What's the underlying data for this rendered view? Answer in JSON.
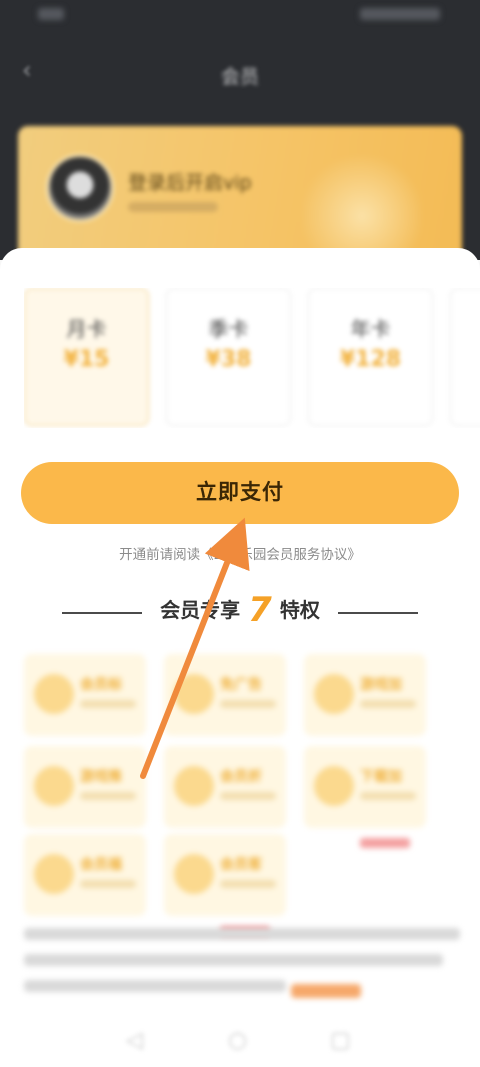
{
  "header": {
    "title": "会员",
    "back_glyph": "‹"
  },
  "vip_card": {
    "username": "登录后开启vip"
  },
  "plans": [
    {
      "name": "月卡",
      "price": "¥15"
    },
    {
      "name": "季卡",
      "price": "¥38"
    },
    {
      "name": "年卡",
      "price": "¥128"
    },
    {
      "name": "",
      "price": "¥"
    }
  ],
  "pay_button": {
    "label": "立即支付"
  },
  "agreement": {
    "text": "开通前请阅读《233乐园会员服务协议》"
  },
  "privileges": {
    "prefix": "会员专享",
    "count": "7",
    "suffix": "特权",
    "items": [
      {
        "title": "会员标"
      },
      {
        "title": "免广告"
      },
      {
        "title": "游戏加"
      },
      {
        "title": "游戏推"
      },
      {
        "title": "会员折"
      },
      {
        "title": "下载加"
      },
      {
        "title": "会员福"
      },
      {
        "title": "会员客"
      }
    ]
  },
  "navbar": {
    "back": "◁",
    "home": "○",
    "recent": "▢"
  },
  "colors": {
    "accent": "#fbb84a",
    "dark_header": "#2b2d31",
    "arrow": "#f08a3c",
    "privilege_number": "#f5a127"
  }
}
